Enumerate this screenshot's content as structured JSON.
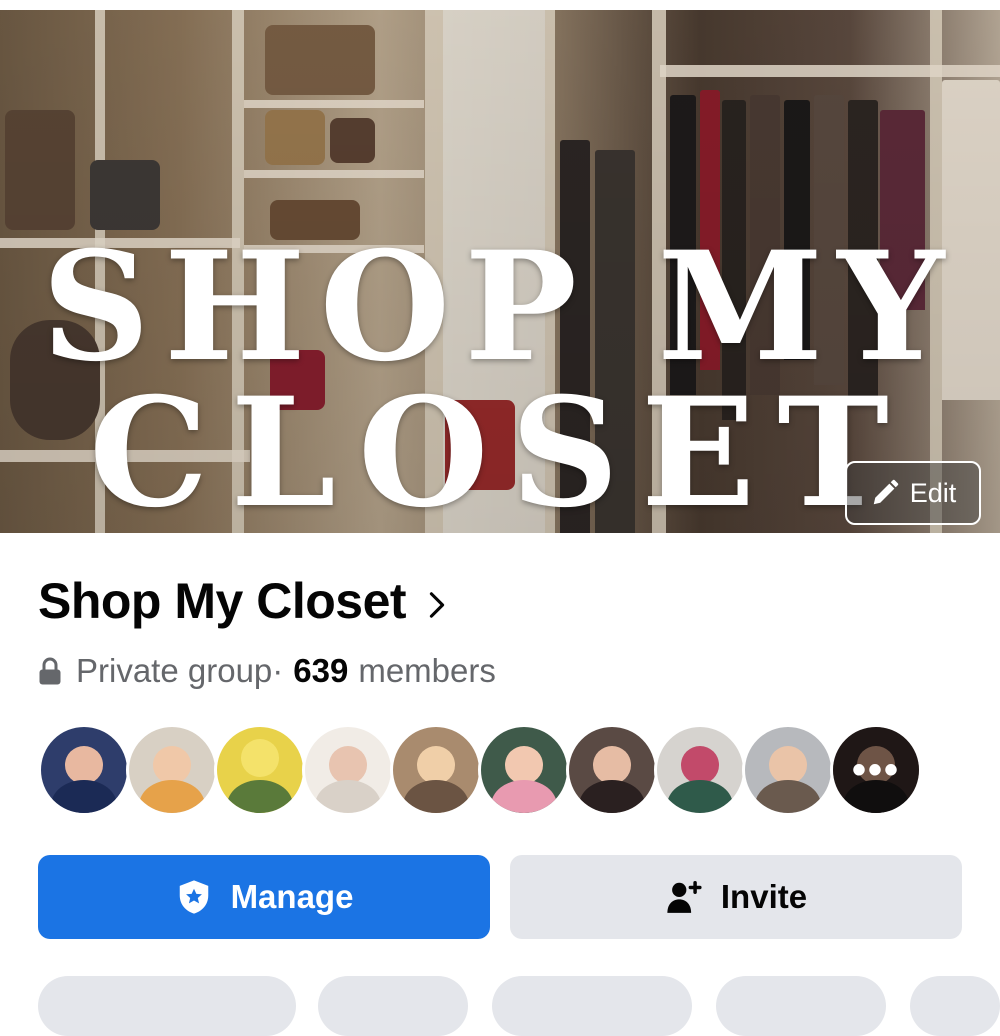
{
  "cover": {
    "title_line1": "SHOP MY",
    "title_line2": "CLOSET",
    "edit_label": "Edit"
  },
  "group": {
    "name": "Shop My Closet",
    "privacy": "Private group",
    "separator": " · ",
    "member_count": "639",
    "member_suffix": "members"
  },
  "avatars": {
    "count_shown": 10,
    "more_icon_text": "•••"
  },
  "actions": {
    "manage_label": "Manage",
    "invite_label": "Invite"
  },
  "colors": {
    "primary_blue": "#1b74e4",
    "secondary_gray": "#e4e6eb",
    "meta_text": "#65676b"
  },
  "icons": [
    "pencil-icon",
    "chevron-right-icon",
    "lock-icon",
    "shield-star-icon",
    "add-person-icon",
    "more-dots-icon"
  ]
}
